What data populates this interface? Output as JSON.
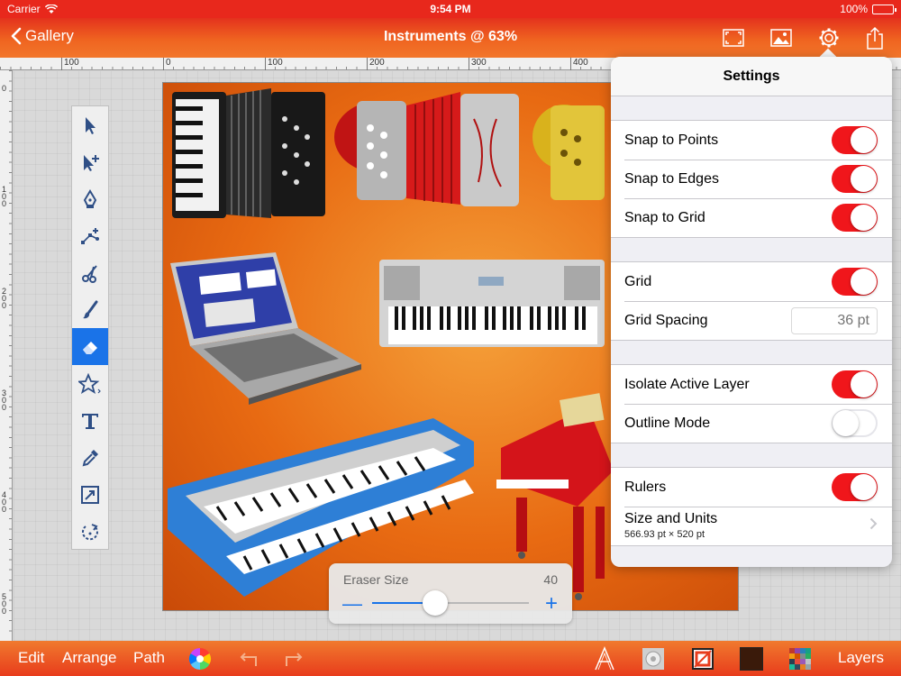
{
  "status": {
    "carrier": "Carrier",
    "time": "9:54 PM",
    "battery": "100%"
  },
  "navbar": {
    "back_label": "Gallery",
    "title": "Instruments @ 63%"
  },
  "ruler": {
    "top_labels": [
      "100",
      "0",
      "100",
      "200",
      "300",
      "400"
    ],
    "left_labels": [
      "0",
      "100",
      "200",
      "300",
      "400",
      "500"
    ]
  },
  "eraser": {
    "label": "Eraser Size",
    "value": "40",
    "level_percent": 40
  },
  "bottombar": {
    "edit": "Edit",
    "arrange": "Arrange",
    "path": "Path",
    "layers": "Layers",
    "fill_color": "#3a1a0a"
  },
  "settings": {
    "title": "Settings",
    "snap_points": "Snap to Points",
    "snap_edges": "Snap to Edges",
    "snap_grid": "Snap to Grid",
    "grid": "Grid",
    "grid_spacing": "Grid Spacing",
    "grid_spacing_placeholder": "36 pt",
    "isolate": "Isolate Active Layer",
    "outline": "Outline Mode",
    "rulers": "Rulers",
    "size_units": "Size and Units",
    "size_value": "566.93 pt × 520 pt"
  },
  "colors": {
    "accent": "#1a73e8",
    "switch_on": "#f0161b",
    "bar_red": "#e83c1c"
  }
}
